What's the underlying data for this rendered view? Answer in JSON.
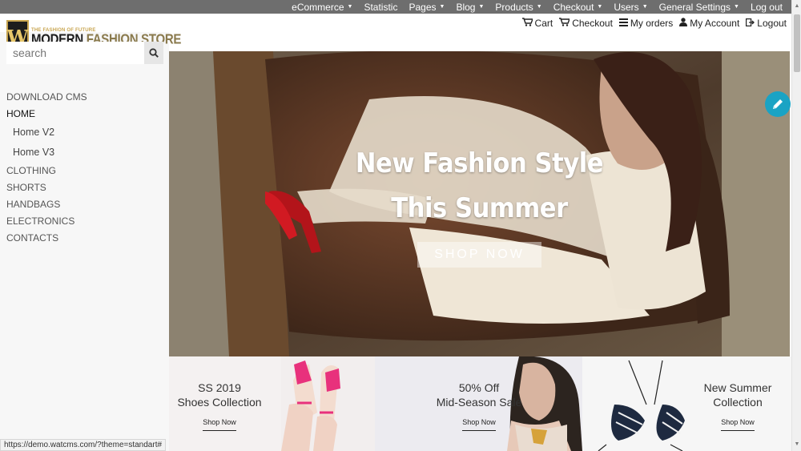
{
  "adminbar": {
    "items": [
      {
        "label": "eCommerce",
        "caret": true
      },
      {
        "label": "Statistic",
        "caret": false
      },
      {
        "label": "Pages",
        "caret": true
      },
      {
        "label": "Blog",
        "caret": true
      },
      {
        "label": "Products",
        "caret": true
      },
      {
        "label": "Checkout",
        "caret": true
      },
      {
        "label": "Users",
        "caret": true
      },
      {
        "label": "General Settings",
        "caret": true
      },
      {
        "label": "Log out",
        "caret": false
      }
    ]
  },
  "logo": {
    "tagline": "THE FASHION OF FUTURE",
    "letter": "W",
    "name_a": "MODERN ",
    "name_b": "FASHION STORE"
  },
  "usernav": {
    "items": [
      {
        "label": "Cart",
        "icon": "cart-icon"
      },
      {
        "label": "Checkout",
        "icon": "cart-icon"
      },
      {
        "label": "My orders",
        "icon": "list-icon"
      },
      {
        "label": "My Account",
        "icon": "user-icon"
      },
      {
        "label": "Logout",
        "icon": "logout-icon"
      }
    ]
  },
  "search": {
    "placeholder": "search"
  },
  "menu": {
    "download": "DOWNLOAD CMS",
    "home": "HOME",
    "home_v2": "Home V2",
    "home_v3": "Home V3",
    "clothing": "CLOTHING",
    "shorts": "SHORTS",
    "handbags": "HANDBAGS",
    "electronics": "ELECTRONICS",
    "contacts": "CONTACTS"
  },
  "hero": {
    "line1": "New Fashion Style",
    "line2": "This Summer",
    "cta": "SHOP NOW"
  },
  "promos": [
    {
      "line1": "SS 2019",
      "line2": "Shoes Collection",
      "link": "Shop Now"
    },
    {
      "line1": "50% Off",
      "line2": "Mid-Season Sale",
      "link": "Shop Now"
    },
    {
      "line1": "New Summer",
      "line2": "Collection",
      "link": "Shop Now"
    }
  ],
  "status_url": "https://demo.watcms.com/?theme=standart#",
  "colors": {
    "accent": "#1aa3c4",
    "adminbar": "#6e6e6e",
    "logo_gold": "#c8a550"
  }
}
